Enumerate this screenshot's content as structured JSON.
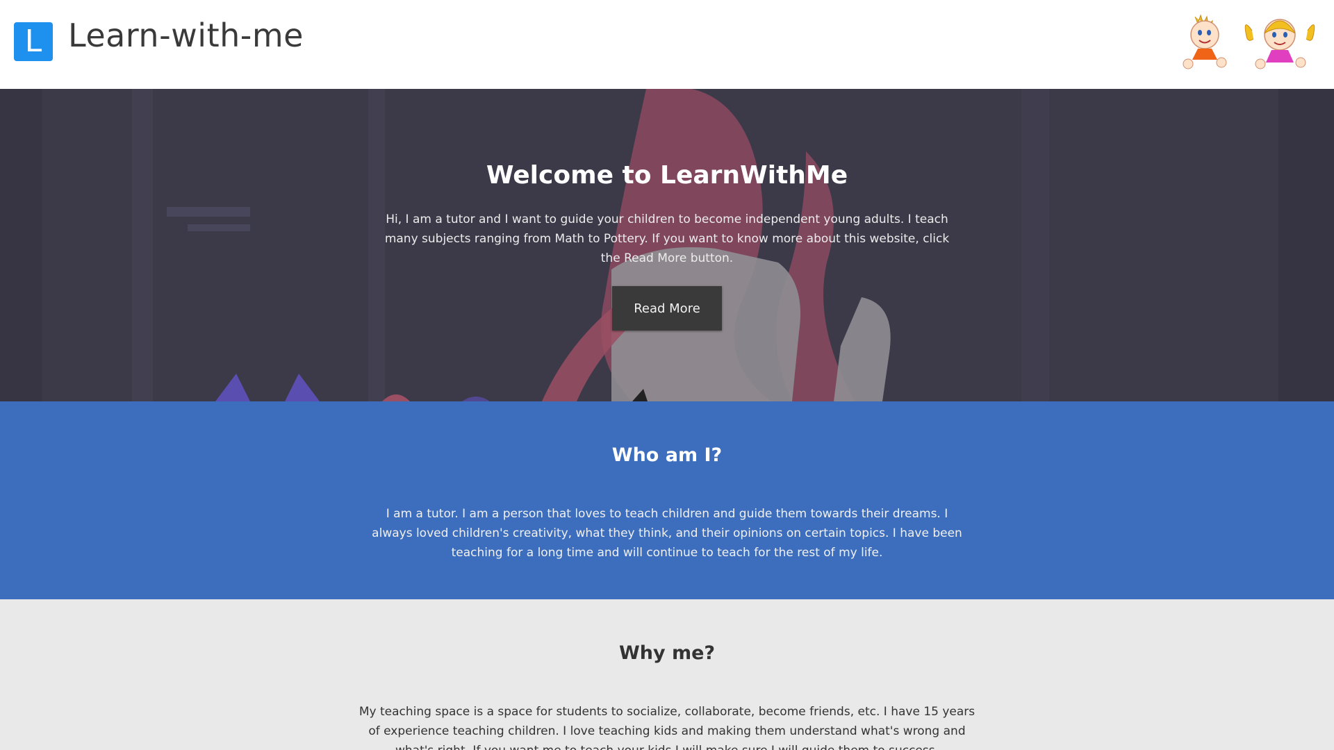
{
  "header": {
    "logo_letter": "L",
    "site_title": "Learn-with-me"
  },
  "hero": {
    "title": "Welcome to LearnWithMe",
    "text": "Hi, I am a tutor and I want to guide your children to become independent young adults. I teach many subjects ranging from Math to Pottery. If you want to know more about this website, click the Read More button.",
    "button_label": "Read More"
  },
  "about": {
    "heading": "Who am I?",
    "text": "I am a tutor. I am a person that loves to teach children and guide them towards their dreams. I always loved children's creativity, what they think, and their opinions on certain topics. I have been teaching for a long time and will continue to teach for the rest of my life."
  },
  "why": {
    "heading": "Why me?",
    "text": "My teaching space is a space for students to socialize, collaborate, become friends, etc. I have 15 years of experience teaching children. I love teaching kids and making them understand what's wrong and what's right. If you want me to teach your kids I will make sure I will guide them to success."
  },
  "colors": {
    "logo": "#1e90ee",
    "hero_bg": "#3c3a49",
    "about_bg": "#3d6ebd",
    "why_bg": "#e9e9ea",
    "button_bg": "#3a3a3a"
  },
  "icons": {
    "logo": "logo-icon",
    "kids": "kids-illustration"
  }
}
